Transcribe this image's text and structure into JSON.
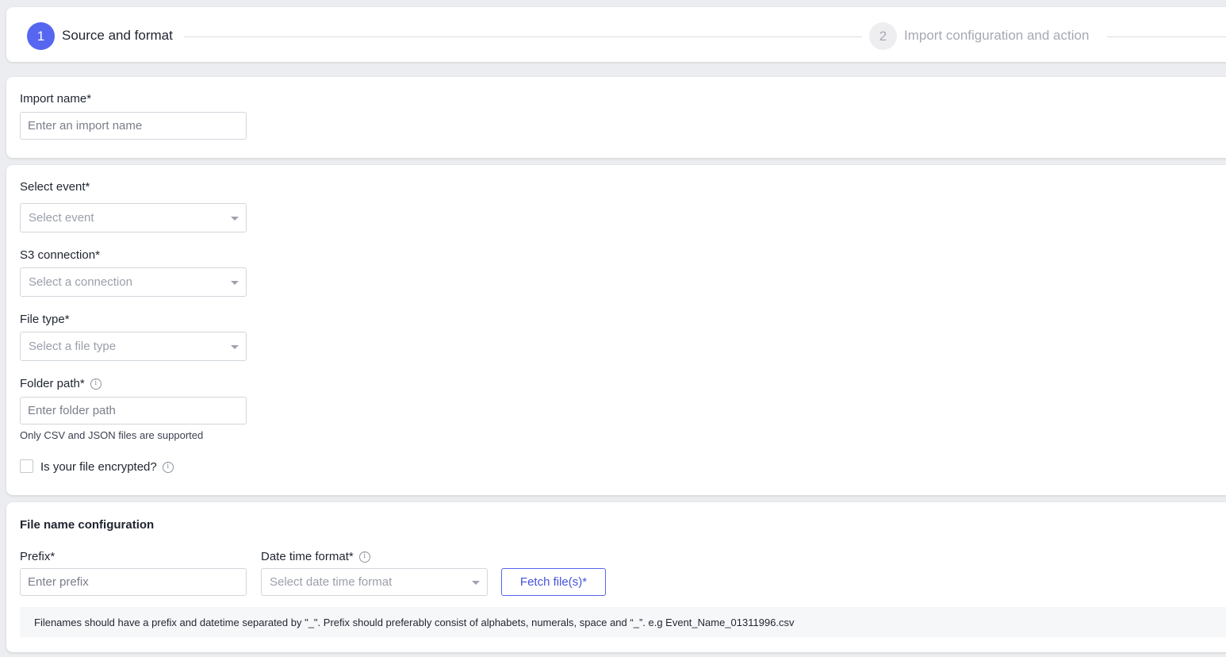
{
  "stepper": {
    "steps": [
      {
        "number": "1",
        "label": "Source and format",
        "state": "active"
      },
      {
        "number": "2",
        "label": "Import configuration and action",
        "state": "inactive"
      }
    ]
  },
  "import_name": {
    "label": "Import name*",
    "placeholder": "Enter an import name",
    "value": ""
  },
  "source": {
    "event": {
      "label": "Select event*",
      "placeholder": "Select event"
    },
    "connection": {
      "label": "S3 connection*",
      "placeholder": "Select a connection"
    },
    "file_type": {
      "label": "File type*",
      "placeholder": "Select a file type"
    },
    "folder_path": {
      "label": "Folder path*",
      "info_icon": "info-icon",
      "placeholder": "Enter folder path",
      "value": "",
      "hint": "Only CSV and JSON files are supported"
    },
    "encrypted": {
      "label": "Is your file encrypted?",
      "checked": false,
      "info_icon": "info-icon"
    }
  },
  "file_name_config": {
    "title": "File name configuration",
    "prefix": {
      "label": "Prefix*",
      "placeholder": "Enter prefix",
      "value": ""
    },
    "date_format": {
      "label": "Date time format*",
      "info_icon": "info-icon",
      "placeholder": "Select date time format"
    },
    "fetch_button": "Fetch file(s)*",
    "note": "Filenames should have a prefix and datetime separated by \"_\". Prefix should preferably consist of alphabets, numerals, space and “_”. e.g Event_Name_01311996.csv"
  },
  "colors": {
    "accent": "#5666f0",
    "background": "#ecedf0"
  }
}
